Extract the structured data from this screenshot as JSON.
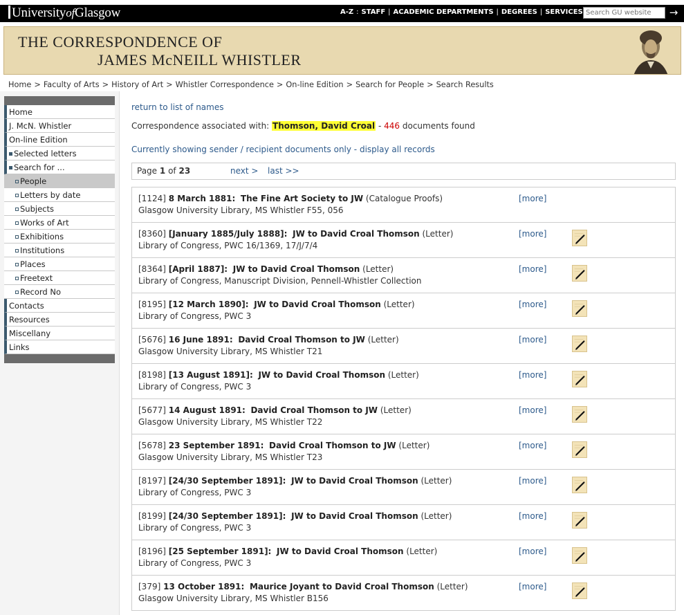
{
  "topbar": {
    "logo_prefix": "University",
    "logo_of": "of",
    "logo_suffix": "Glasgow",
    "nav": [
      "A-Z",
      "STAFF",
      "ACADEMIC DEPARTMENTS",
      "DEGREES",
      "SERVICES"
    ],
    "nav_colon_sep": ":",
    "search_placeholder": "Search GU website",
    "go_glyph": "→"
  },
  "banner": {
    "line1": "THE CORRESPONDENCE OF",
    "line2": "JAMES McNEILL WHISTLER"
  },
  "breadcrumb": [
    "Home",
    "Faculty of Arts",
    "History of Art",
    "Whistler Correspondence",
    "On-line Edition",
    "Search for People",
    "Search Results"
  ],
  "sidebar": {
    "items": [
      {
        "label": "Home",
        "level": 0
      },
      {
        "label": "J. McN. Whistler",
        "level": 0
      },
      {
        "label": "On-line Edition",
        "level": 0
      },
      {
        "label": "Selected letters",
        "level": 1
      },
      {
        "label": "Search for ...",
        "level": 1
      },
      {
        "label": "People",
        "level": 2,
        "active": true
      },
      {
        "label": "Letters by date",
        "level": 2
      },
      {
        "label": "Subjects",
        "level": 2
      },
      {
        "label": "Works of Art",
        "level": 2
      },
      {
        "label": "Exhibitions",
        "level": 2
      },
      {
        "label": "Institutions",
        "level": 2
      },
      {
        "label": "Places",
        "level": 2
      },
      {
        "label": "Freetext",
        "level": 2
      },
      {
        "label": "Record No",
        "level": 2
      },
      {
        "label": "Contacts",
        "level": 0
      },
      {
        "label": "Resources",
        "level": 0
      },
      {
        "label": "Miscellany",
        "level": 0
      },
      {
        "label": "Links",
        "level": 0
      }
    ]
  },
  "main": {
    "return_link": "return to list of names",
    "assoc_prefix": "Correspondence associated with:",
    "assoc_name": "Thomson, David Croal",
    "assoc_dash": "-",
    "assoc_count": "446",
    "assoc_suffix": "documents found",
    "showing": "Currently showing sender / recipient documents only - display all records",
    "pager": {
      "prefix": "Page",
      "current": "1",
      "of": "of",
      "total": "23",
      "next": "next >",
      "last": "last >>"
    },
    "more_label": "[more]",
    "results": [
      {
        "id": "[1124]",
        "date": "8 March 1881:",
        "parties": "The Fine Art Society to JW",
        "kind": "(Catalogue Proofs)",
        "location": "Glasgow University Library, MS Whistler F55, 056",
        "has_edit": false
      },
      {
        "id": "[8360]",
        "date": "[January 1885/July 1888]:",
        "parties": "JW to David Croal Thomson",
        "kind": "(Letter)",
        "location": "Library of Congress, PWC 16/1369, 17/J/7/4",
        "has_edit": true
      },
      {
        "id": "[8364]",
        "date": "[April 1887]:",
        "parties": "JW to David Croal Thomson",
        "kind": "(Letter)",
        "location": "Library of Congress, Manuscript Division, Pennell-Whistler Collection",
        "has_edit": true
      },
      {
        "id": "[8195]",
        "date": "[12 March 1890]:",
        "parties": "JW to David Croal Thomson",
        "kind": "(Letter)",
        "location": "Library of Congress, PWC 3",
        "has_edit": true
      },
      {
        "id": "[5676]",
        "date": "16 June 1891:",
        "parties": "David Croal Thomson to JW",
        "kind": "(Letter)",
        "location": "Glasgow University Library, MS Whistler T21",
        "has_edit": true
      },
      {
        "id": "[8198]",
        "date": "[13 August 1891]:",
        "parties": "JW to David Croal Thomson",
        "kind": "(Letter)",
        "location": "Library of Congress, PWC 3",
        "has_edit": true
      },
      {
        "id": "[5677]",
        "date": "14 August 1891:",
        "parties": "David Croal Thomson to JW",
        "kind": "(Letter)",
        "location": "Glasgow University Library, MS Whistler T22",
        "has_edit": true
      },
      {
        "id": "[5678]",
        "date": "23 September 1891:",
        "parties": "David Croal Thomson to JW",
        "kind": "(Letter)",
        "location": "Glasgow University Library, MS Whistler T23",
        "has_edit": true
      },
      {
        "id": "[8197]",
        "date": "[24/30 September 1891]:",
        "parties": "JW to David Croal Thomson",
        "kind": "(Letter)",
        "location": "Library of Congress, PWC 3",
        "has_edit": true
      },
      {
        "id": "[8199]",
        "date": "[24/30 September 1891]:",
        "parties": "JW to David Croal Thomson",
        "kind": "(Letter)",
        "location": "Library of Congress, PWC 3",
        "has_edit": true
      },
      {
        "id": "[8196]",
        "date": "[25 September 1891]:",
        "parties": "JW to David Croal Thomson",
        "kind": "(Letter)",
        "location": "Library of Congress, PWC 3",
        "has_edit": true
      },
      {
        "id": "[379]",
        "date": "13 October 1891:",
        "parties": "Maurice Joyant to David Croal Thomson",
        "kind": "(Letter)",
        "location": "Glasgow University Library, MS Whistler B156",
        "has_edit": true
      }
    ]
  }
}
